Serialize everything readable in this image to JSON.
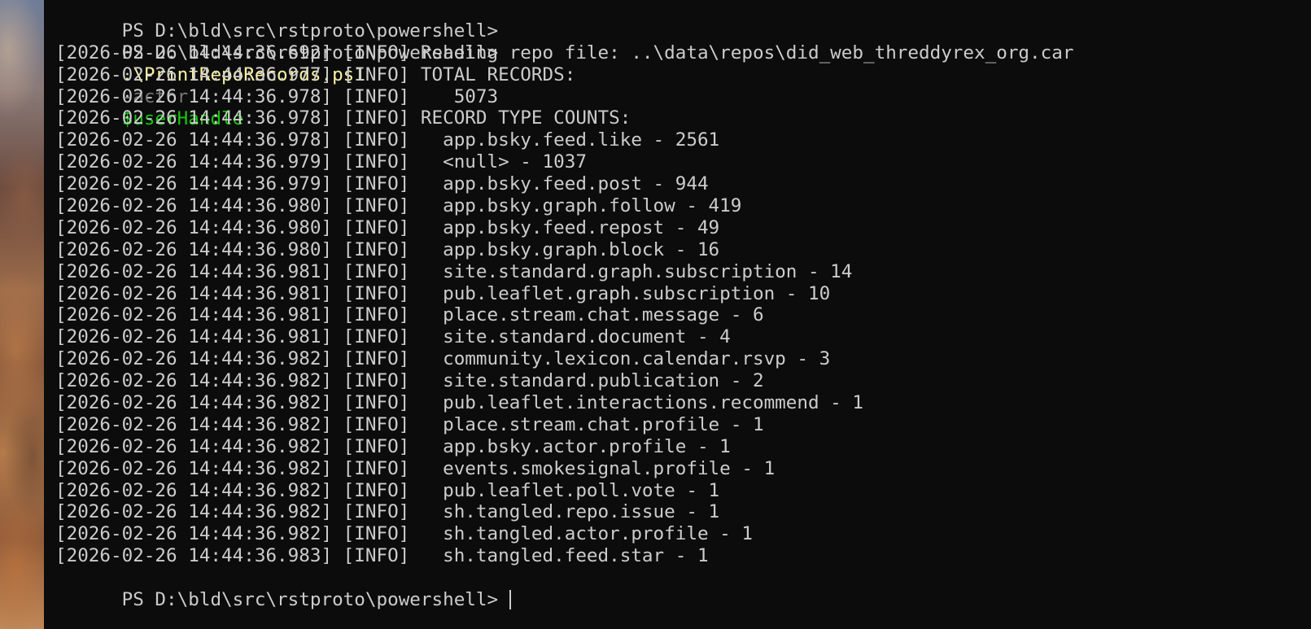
{
  "terminal": {
    "prompt_path": "PS D:\\bld\\src\\rstproto\\powershell>",
    "command": {
      "script": ".\\PrintRepoRecords.ps1",
      "param": "-actor",
      "variable": "$userHandle"
    },
    "log_lines": [
      "[2026-02-26 14:44:36.692] [INFO] Reading repo file: ..\\data\\repos\\did_web_threddyrex_org.car",
      "[2026-02-26 14:44:36.977] [INFO] TOTAL RECORDS:",
      "[2026-02-26 14:44:36.978] [INFO]    5073",
      "[2026-02-26 14:44:36.978] [INFO] RECORD TYPE COUNTS:",
      "[2026-02-26 14:44:36.978] [INFO]   app.bsky.feed.like - 2561",
      "[2026-02-26 14:44:36.979] [INFO]   <null> - 1037",
      "[2026-02-26 14:44:36.979] [INFO]   app.bsky.feed.post - 944",
      "[2026-02-26 14:44:36.980] [INFO]   app.bsky.graph.follow - 419",
      "[2026-02-26 14:44:36.980] [INFO]   app.bsky.feed.repost - 49",
      "[2026-02-26 14:44:36.980] [INFO]   app.bsky.graph.block - 16",
      "[2026-02-26 14:44:36.981] [INFO]   site.standard.graph.subscription - 14",
      "[2026-02-26 14:44:36.981] [INFO]   pub.leaflet.graph.subscription - 10",
      "[2026-02-26 14:44:36.981] [INFO]   place.stream.chat.message - 6",
      "[2026-02-26 14:44:36.981] [INFO]   site.standard.document - 4",
      "[2026-02-26 14:44:36.982] [INFO]   community.lexicon.calendar.rsvp - 3",
      "[2026-02-26 14:44:36.982] [INFO]   site.standard.publication - 2",
      "[2026-02-26 14:44:36.982] [INFO]   pub.leaflet.interactions.recommend - 1",
      "[2026-02-26 14:44:36.982] [INFO]   place.stream.chat.profile - 1",
      "[2026-02-26 14:44:36.982] [INFO]   app.bsky.actor.profile - 1",
      "[2026-02-26 14:44:36.982] [INFO]   events.smokesignal.profile - 1",
      "[2026-02-26 14:44:36.982] [INFO]   pub.leaflet.poll.vote - 1",
      "[2026-02-26 14:44:36.982] [INFO]   sh.tangled.repo.issue - 1",
      "[2026-02-26 14:44:36.982] [INFO]   sh.tangled.actor.profile - 1",
      "[2026-02-26 14:44:36.983] [INFO]   sh.tangled.feed.star - 1"
    ]
  },
  "colors": {
    "background": "#0c0c0c",
    "foreground": "#cccccc",
    "script": "#f9f1a5",
    "parameter": "#767676",
    "variable": "#16c60c"
  }
}
